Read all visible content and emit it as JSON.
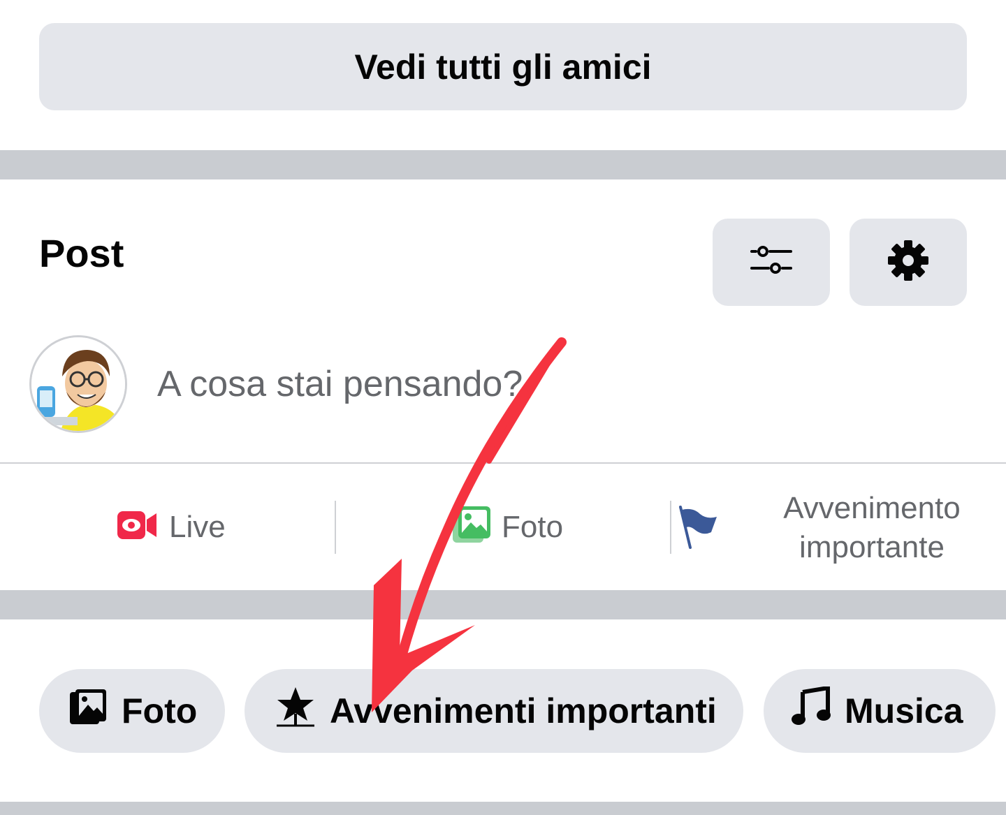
{
  "friends": {
    "see_all_label": "Vedi tutti gli amici"
  },
  "posts": {
    "title": "Post",
    "filter_button_icon": "sliders-icon",
    "settings_button_icon": "gear-icon",
    "composer": {
      "placeholder": "A cosa stai pensando?"
    },
    "actions": [
      {
        "label": "Live",
        "icon": "video-camera-icon",
        "color": "#f02849"
      },
      {
        "label": "Foto",
        "icon": "photo-icon",
        "color": "#45bd62"
      },
      {
        "label": "Avvenimento importante",
        "icon": "flag-icon",
        "color": "#3b5998"
      }
    ]
  },
  "chips": [
    {
      "label": "Foto",
      "icon": "photos-icon"
    },
    {
      "label": "Avvenimenti importanti",
      "icon": "star-milestone-icon"
    },
    {
      "label": "Musica",
      "icon": "music-note-icon"
    }
  ],
  "annotation": {
    "arrow_color": "#f5333f",
    "arrow_icon": "red-arrow-annotation"
  }
}
